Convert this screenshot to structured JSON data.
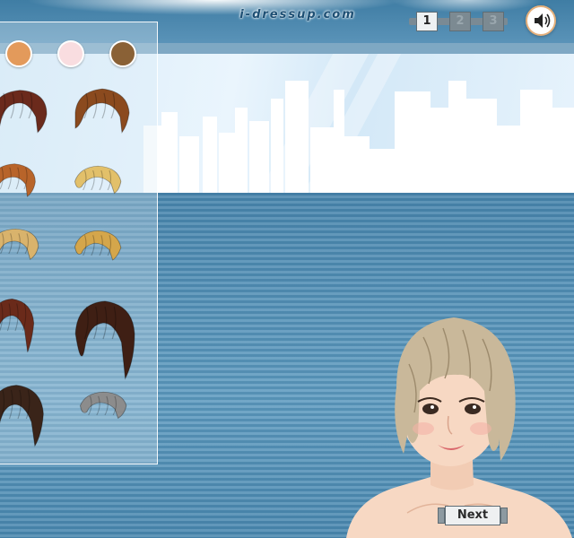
{
  "header": {
    "logo_text": "i-dressup.com"
  },
  "steps": [
    {
      "label": "1",
      "active": true
    },
    {
      "label": "2",
      "active": false
    },
    {
      "label": "3",
      "active": false
    }
  ],
  "sound_button": {
    "icon": "speaker-icon"
  },
  "skin_tones": [
    {
      "name": "tan",
      "color": "#e39a5b"
    },
    {
      "name": "pale-pink",
      "color": "#f9dde0"
    },
    {
      "name": "brown",
      "color": "#8a6136"
    }
  ],
  "hairstyles": [
    {
      "id": "hair-1",
      "color": "#6b2a1c"
    },
    {
      "id": "hair-2",
      "color": "#8b4a1e"
    },
    {
      "id": "hair-3",
      "color": "#b8642a"
    },
    {
      "id": "hair-4",
      "color": "#e2c06a"
    },
    {
      "id": "hair-5",
      "color": "#d9b36c"
    },
    {
      "id": "hair-6",
      "color": "#d4a64b"
    },
    {
      "id": "hair-7",
      "color": "#6a2a1a"
    },
    {
      "id": "hair-8",
      "color": "#3f1f14"
    },
    {
      "id": "hair-9",
      "color": "#3a2419"
    },
    {
      "id": "hair-10",
      "color": "#8c8c8c"
    }
  ],
  "character": {
    "hair_color": "#c9b89a",
    "skin_color": "#f7d8c3"
  },
  "next_button": {
    "label": "Next"
  }
}
